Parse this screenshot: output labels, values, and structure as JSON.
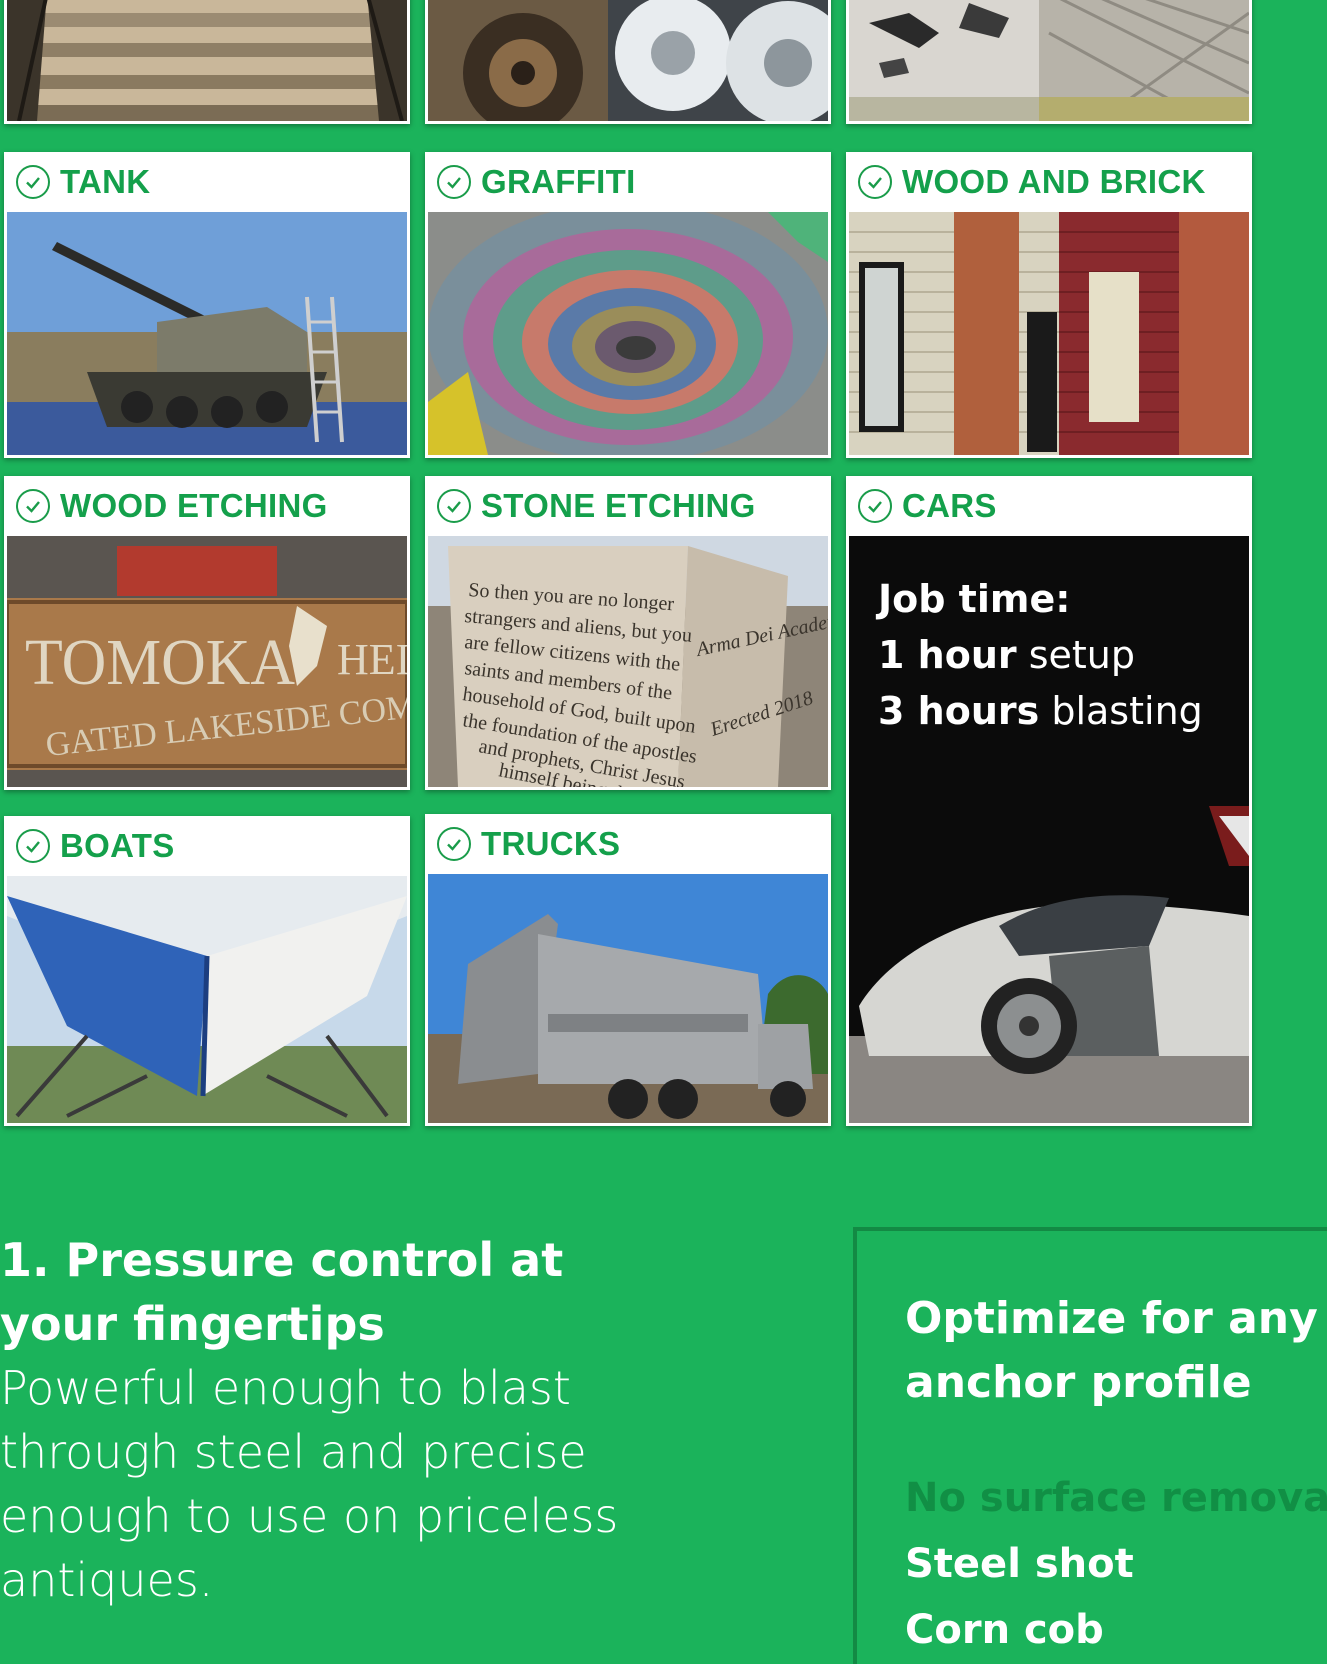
{
  "cards": [
    {
      "label": "TANK"
    },
    {
      "label": "GRAFFITI"
    },
    {
      "label": "WOOD AND BRICK"
    },
    {
      "label": "WOOD ETCHING"
    },
    {
      "label": "STONE ETCHING"
    },
    {
      "label": "CARS"
    },
    {
      "label": "BOATS"
    },
    {
      "label": "TRUCKS"
    }
  ],
  "cars_panel": {
    "job_time_label": "Job time:",
    "setup_value": "1 hour",
    "setup_label": "setup",
    "blasting_value": "3 hours",
    "blasting_label": "blasting"
  },
  "wood_etching_sign": {
    "line1": "TOMOKA",
    "line1_right": "HEIG",
    "line2": "GATED LAKESIDE COMMU"
  },
  "stone_etching_text": {
    "front": [
      "So then you are no longer",
      "strangers and aliens, but you",
      "are fellow citizens with the",
      "saints and members of the",
      "household of God, built upon",
      "the foundation of the apostles",
      "and prophets, Christ Jesus",
      "himself being th"
    ],
    "side": [
      "Arma Dei Academy",
      "Erected 2018"
    ]
  },
  "feature": {
    "title_line1": "1. Pressure control at",
    "title_line2": "your fingertips",
    "body_line1": "Powerful enough to blast",
    "body_line2": "through steel and precise",
    "body_line3": "enough to use on priceless",
    "body_line4": "antiques."
  },
  "profile": {
    "title_line1": "Optimize for any",
    "title_line2": "anchor profile",
    "items": [
      {
        "label": "No surface removal"
      },
      {
        "label": "Steel shot"
      },
      {
        "label": "Corn cob"
      }
    ]
  },
  "colors": {
    "background": "#1bb35b",
    "label_green": "#14a04b",
    "muted_green": "#118f45"
  }
}
